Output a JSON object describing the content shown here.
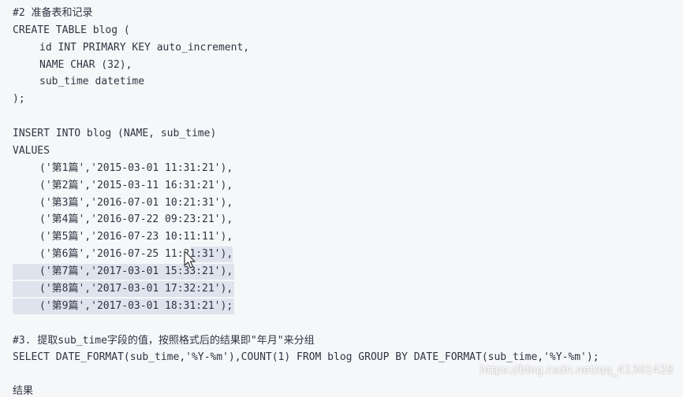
{
  "code": {
    "lines": [
      "#2 准备表和记录",
      "CREATE TABLE blog (",
      "id INT PRIMARY KEY auto_increment,",
      "NAME CHAR (32),",
      "sub_time datetime",
      ");",
      "INSERT INTO blog (NAME, sub_time)",
      "VALUES",
      "('第1篇','2015-03-01 11:31:21'),",
      "('第2篇','2015-03-11 16:31:21'),",
      "('第3篇','2016-07-01 10:21:31'),",
      "('第4篇','2016-07-22 09:23:21'),",
      "('第5篇','2016-07-23 10:11:11'),",
      "('第6篇','2016-07-25 11:21:31'),",
      "('第7篇','2017-03-01 15:33:21'),",
      "('第8篇','2017-03-01 17:32:21'),",
      "('第9篇','2017-03-01 18:31:21');",
      "#3. 提取sub_time字段的值，按照格式后的结果即\"年月\"来分组",
      "SELECT DATE_FORMAT(sub_time,'%Y-%m'),COUNT(1) FROM blog GROUP BY DATE_FORMAT(sub_time,'%Y-%m');"
    ],
    "cutoff_line": "结果"
  },
  "watermark": "https://blog.csdn.net/qq_41301428",
  "colors": {
    "background": "#f6f7f9",
    "text": "#2f3440",
    "highlight": "#dfe3ee"
  },
  "icons": {
    "cursor": "mouse-pointer-icon"
  }
}
